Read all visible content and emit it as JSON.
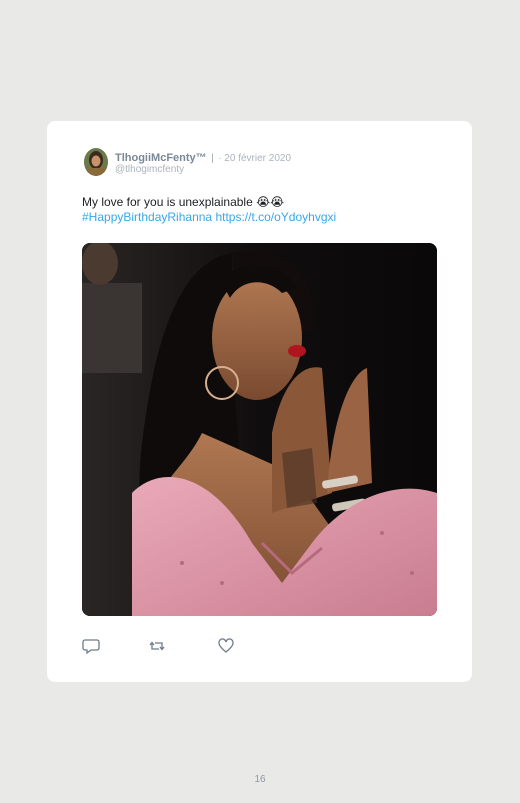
{
  "tweet": {
    "display_name": "TlhogiiMcFenty™",
    "separator": "|",
    "date": "· 20 février 2020",
    "handle": "@tlhogimcfenty",
    "text": "My love for you is unexplainable",
    "emoji": "😭😭",
    "hashtag": "#HappyBirthdayRihanna",
    "link": "https://t.co/oYdoyhvgxi"
  },
  "actions": {
    "reply_icon": "reply-icon",
    "retweet_icon": "retweet-icon",
    "like_icon": "heart-icon"
  },
  "page": {
    "number": "16"
  },
  "colors": {
    "background": "#e9e9e8",
    "card": "#ffffff",
    "link": "#3aa6e8",
    "meta": "#aab3bc"
  }
}
